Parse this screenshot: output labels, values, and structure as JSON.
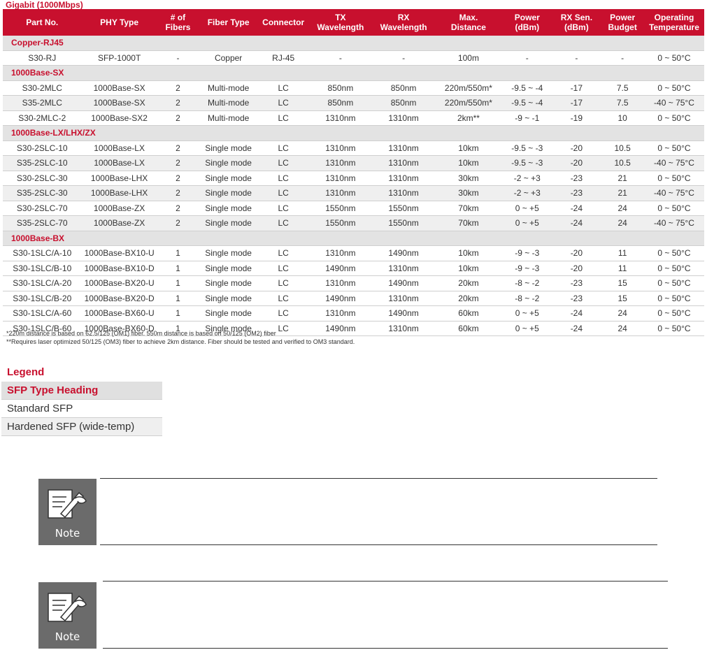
{
  "page_title": "Gigabit (1000Mbps)",
  "colors": {
    "accent": "#c8102e",
    "section_bg": "#e3e3e3",
    "hardened_bg": "#efefef"
  },
  "table": {
    "headers": [
      "Part No.",
      "PHY Type",
      "# of\nFibers",
      "Fiber Type",
      "Connector",
      "TX\nWavelength",
      "RX\nWavelength",
      "Max.\nDistance",
      "Power\n(dBm)",
      "RX Sen.\n(dBm)",
      "Power\nBudget",
      "Operating\nTemperature"
    ],
    "sections": [
      {
        "name": "Copper-RJ45",
        "rows": [
          {
            "hardened": false,
            "cells": [
              "S30-RJ",
              "SFP-1000T",
              "-",
              "Copper",
              "RJ-45",
              "-",
              "-",
              "100m",
              "-",
              "-",
              "-",
              "0 ~ 50°C"
            ]
          }
        ]
      },
      {
        "name": "1000Base-SX",
        "rows": [
          {
            "hardened": false,
            "cells": [
              "S30-2MLC",
              "1000Base-SX",
              "2",
              "Multi-mode",
              "LC",
              "850nm",
              "850nm",
              "220m/550m*",
              "-9.5 ~ -4",
              "-17",
              "7.5",
              "0 ~ 50°C"
            ]
          },
          {
            "hardened": true,
            "cells": [
              "S35-2MLC",
              "1000Base-SX",
              "2",
              "Multi-mode",
              "LC",
              "850nm",
              "850nm",
              "220m/550m*",
              "-9.5 ~ -4",
              "-17",
              "7.5",
              "-40 ~ 75°C"
            ]
          },
          {
            "hardened": false,
            "cells": [
              "S30-2MLC-2",
              "1000Base-SX2",
              "2",
              "Multi-mode",
              "LC",
              "1310nm",
              "1310nm",
              "2km**",
              "-9 ~ -1",
              "-19",
              "10",
              "0 ~ 50°C"
            ]
          }
        ]
      },
      {
        "name": "1000Base-LX/LHX/ZX",
        "rows": [
          {
            "hardened": false,
            "cells": [
              "S30-2SLC-10",
              "1000Base-LX",
              "2",
              "Single mode",
              "LC",
              "1310nm",
              "1310nm",
              "10km",
              "-9.5 ~ -3",
              "-20",
              "10.5",
              "0 ~ 50°C"
            ]
          },
          {
            "hardened": true,
            "cells": [
              "S35-2SLC-10",
              "1000Base-LX",
              "2",
              "Single mode",
              "LC",
              "1310nm",
              "1310nm",
              "10km",
              "-9.5 ~ -3",
              "-20",
              "10.5",
              "-40 ~ 75°C"
            ]
          },
          {
            "hardened": false,
            "cells": [
              "S30-2SLC-30",
              "1000Base-LHX",
              "2",
              "Single mode",
              "LC",
              "1310nm",
              "1310nm",
              "30km",
              "-2 ~ +3",
              "-23",
              "21",
              "0 ~ 50°C"
            ]
          },
          {
            "hardened": true,
            "cells": [
              "S35-2SLC-30",
              "1000Base-LHX",
              "2",
              "Single mode",
              "LC",
              "1310nm",
              "1310nm",
              "30km",
              "-2 ~ +3",
              "-23",
              "21",
              "-40 ~ 75°C"
            ]
          },
          {
            "hardened": false,
            "cells": [
              "S30-2SLC-70",
              "1000Base-ZX",
              "2",
              "Single mode",
              "LC",
              "1550nm",
              "1550nm",
              "70km",
              "0 ~ +5",
              "-24",
              "24",
              "0 ~ 50°C"
            ]
          },
          {
            "hardened": true,
            "cells": [
              "S35-2SLC-70",
              "1000Base-ZX",
              "2",
              "Single mode",
              "LC",
              "1550nm",
              "1550nm",
              "70km",
              "0 ~ +5",
              "-24",
              "24",
              "-40 ~ 75°C"
            ]
          }
        ]
      },
      {
        "name": "1000Base-BX",
        "rows": [
          {
            "hardened": false,
            "cells": [
              "S30-1SLC/A-10",
              "1000Base-BX10-U",
              "1",
              "Single mode",
              "LC",
              "1310nm",
              "1490nm",
              "10km",
              "-9 ~ -3",
              "-20",
              "11",
              "0 ~ 50°C"
            ]
          },
          {
            "hardened": false,
            "cells": [
              "S30-1SLC/B-10",
              "1000Base-BX10-D",
              "1",
              "Single mode",
              "LC",
              "1490nm",
              "1310nm",
              "10km",
              "-9 ~ -3",
              "-20",
              "11",
              "0 ~ 50°C"
            ]
          },
          {
            "hardened": false,
            "cells": [
              "S30-1SLC/A-20",
              "1000Base-BX20-U",
              "1",
              "Single mode",
              "LC",
              "1310nm",
              "1490nm",
              "20km",
              "-8 ~ -2",
              "-23",
              "15",
              "0 ~ 50°C"
            ]
          },
          {
            "hardened": false,
            "cells": [
              "S30-1SLC/B-20",
              "1000Base-BX20-D",
              "1",
              "Single mode",
              "LC",
              "1490nm",
              "1310nm",
              "20km",
              "-8 ~ -2",
              "-23",
              "15",
              "0 ~ 50°C"
            ]
          },
          {
            "hardened": false,
            "cells": [
              "S30-1SLC/A-60",
              "1000Base-BX60-U",
              "1",
              "Single mode",
              "LC",
              "1310nm",
              "1490nm",
              "60km",
              "0 ~ +5",
              "-24",
              "24",
              "0 ~ 50°C"
            ]
          },
          {
            "hardened": false,
            "cells": [
              "S30-1SLC/B-60",
              "1000Base-BX60-D",
              "1",
              "Single mode",
              "LC",
              "1490nm",
              "1310nm",
              "60km",
              "0 ~ +5",
              "-24",
              "24",
              "0 ~ 50°C"
            ]
          }
        ]
      }
    ]
  },
  "footnotes": [
    "*220m distance is based on 62.5/125 (OM1) fiber. 550m distance is based on 50/125 (OM2) fiber",
    "**Requires laser optimized 50/125 (OM3) fiber to achieve 2km distance. Fiber should be tested and verified to OM3 standard."
  ],
  "legend": {
    "title": "Legend",
    "heading": "SFP Type Heading",
    "standard": "Standard SFP",
    "hardened": "Hardened SFP (wide-temp)"
  },
  "notes": [
    {
      "icon": "note-icon",
      "label": "Note"
    },
    {
      "icon": "note-icon",
      "label": "Note"
    }
  ]
}
